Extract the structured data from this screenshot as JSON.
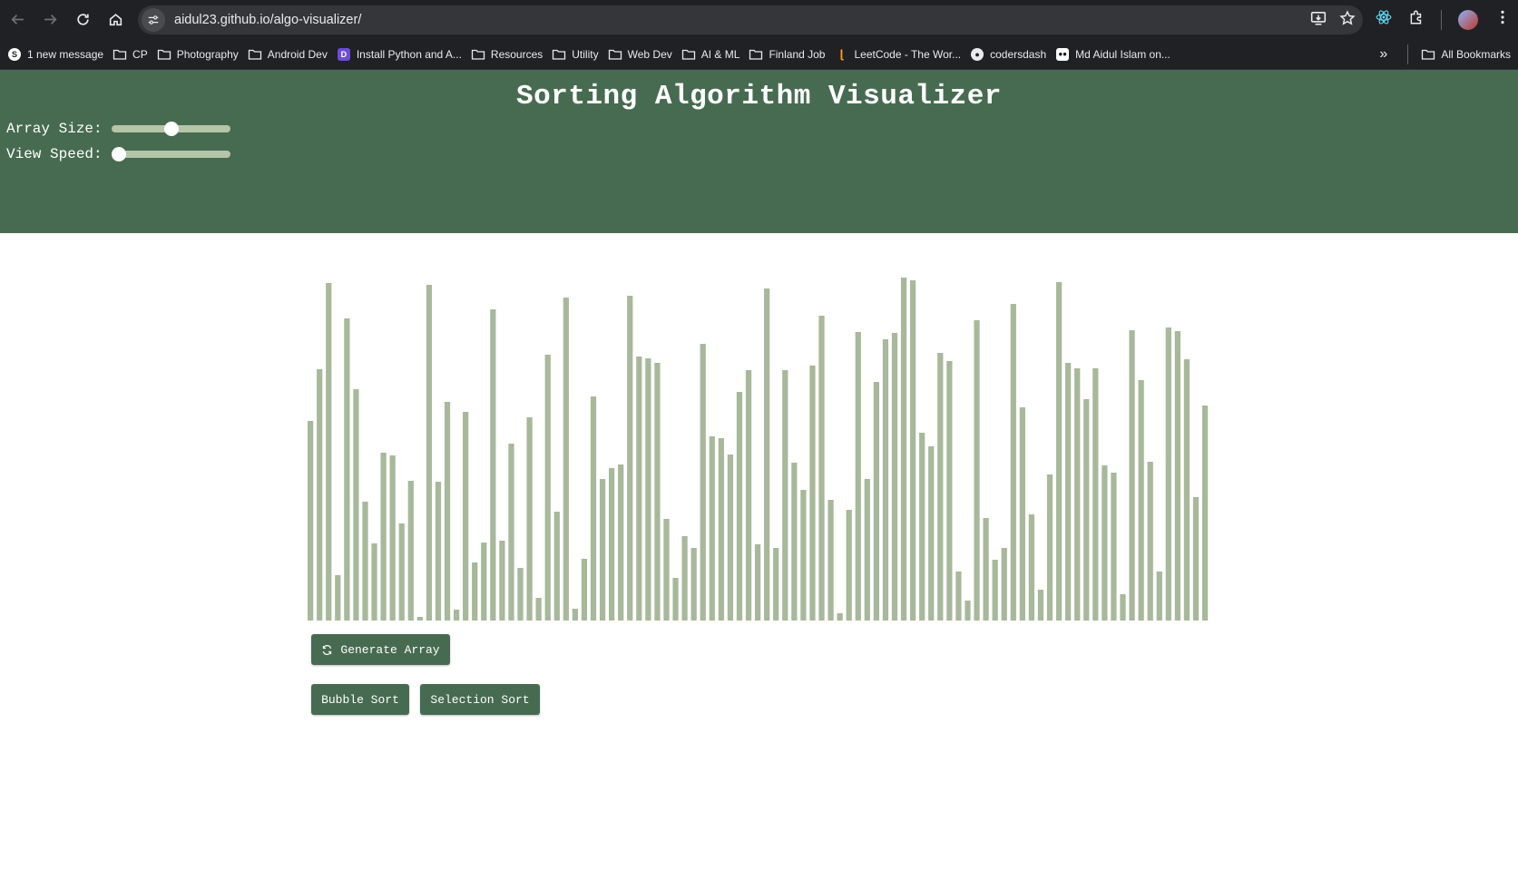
{
  "browser": {
    "url": "aidul23.github.io/algo-visualizer/",
    "bookmarks": [
      {
        "label": "1 new message",
        "icon": "s-favicon-icon"
      },
      {
        "label": "CP",
        "icon": "folder-icon"
      },
      {
        "label": "Photography",
        "icon": "folder-icon"
      },
      {
        "label": "Android Dev",
        "icon": "folder-icon"
      },
      {
        "label": "Install Python and A...",
        "icon": "python-favicon-icon"
      },
      {
        "label": "Resources",
        "icon": "folder-icon"
      },
      {
        "label": "Utility",
        "icon": "folder-icon"
      },
      {
        "label": "Web Dev",
        "icon": "folder-icon"
      },
      {
        "label": "AI & ML",
        "icon": "folder-icon"
      },
      {
        "label": "Finland Job",
        "icon": "folder-icon"
      },
      {
        "label": "LeetCode - The Wor...",
        "icon": "leetcode-favicon-icon"
      },
      {
        "label": "codersdash",
        "icon": "github-icon"
      },
      {
        "label": "Md Aidul Islam on...",
        "icon": "medium-favicon-icon"
      }
    ],
    "all_bookmarks_label": "All Bookmarks"
  },
  "app": {
    "title": "Sorting Algorithm Visualizer",
    "controls": {
      "array_size_label": "Array Size:",
      "array_size_level": 0.5,
      "view_speed_label": "View Speed:",
      "view_speed_level": 0.0
    },
    "buttons": {
      "generate": "Generate Array",
      "bubble": "Bubble Sort",
      "selection": "Selection Sort"
    }
  },
  "colors": {
    "header_bg": "#476b51",
    "bar": "#a8b89b",
    "button_bg": "#476b51"
  },
  "bars": [
    220,
    277,
    372,
    50,
    333,
    255,
    131,
    85,
    185,
    182,
    107,
    154,
    4,
    370,
    153,
    241,
    12,
    230,
    64,
    86,
    343,
    88,
    195,
    58,
    224,
    25,
    293,
    120,
    356,
    13,
    68,
    247,
    156,
    168,
    172,
    358,
    291,
    289,
    284,
    112,
    47,
    93,
    80,
    305,
    203,
    201,
    183,
    252,
    276,
    84,
    366,
    80,
    276,
    174,
    144,
    281,
    336,
    133,
    8,
    122,
    318,
    156,
    263,
    310,
    317,
    378,
    375,
    207,
    192,
    295,
    286,
    54,
    22,
    331,
    113,
    67,
    80,
    349,
    235,
    117,
    34,
    161,
    373,
    284,
    278,
    244,
    278,
    171,
    163,
    29,
    320,
    265,
    175,
    54,
    323,
    319,
    288,
    136,
    237
  ]
}
